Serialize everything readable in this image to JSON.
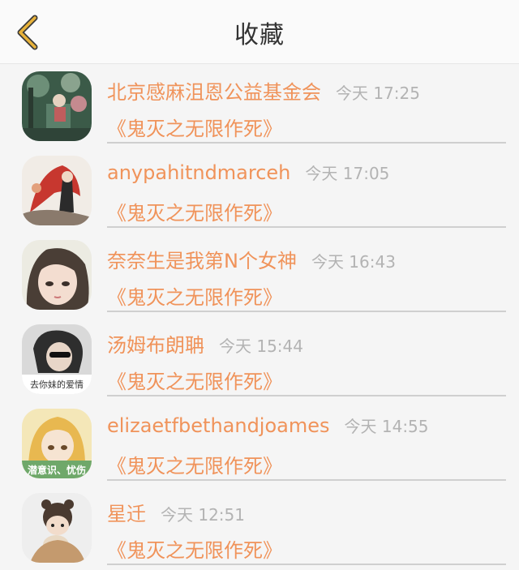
{
  "header": {
    "title": "收藏",
    "back_icon": "chevron-left-icon",
    "accent": "#e8b23a"
  },
  "colors": {
    "accent": "#f0935a",
    "muted": "#b3b3b3"
  },
  "items": [
    {
      "user": "北京感麻沮恩公益基金会",
      "time": "今天 17:25",
      "book": "《鬼灭之无限作死》"
    },
    {
      "user": "anypahitndmarceh",
      "time": "今天 17:05",
      "book": "《鬼灭之无限作死》"
    },
    {
      "user": "奈奈生是我第N个女神",
      "time": "今天 16:43",
      "book": "《鬼灭之无限作死》"
    },
    {
      "user": "汤姆布朗聃",
      "time": "今天 15:44",
      "book": "《鬼灭之无限作死》",
      "avatar_caption": "去你妹的爱情"
    },
    {
      "user": "elizaetfbethandjoames",
      "time": "今天 14:55",
      "book": "《鬼灭之无限作死》",
      "avatar_caption": "潜意识、忧伤"
    },
    {
      "user": "星迁",
      "time": "今天 12:51",
      "book": "《鬼灭之无限作死》"
    }
  ]
}
